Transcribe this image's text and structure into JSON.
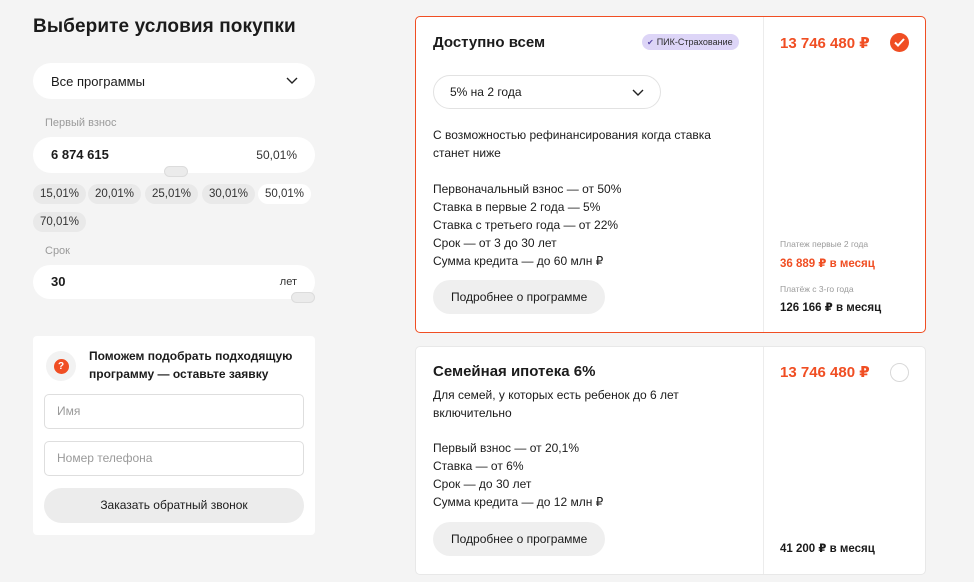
{
  "title": "Выберите условия покупки",
  "program_select": {
    "value": "Все программы",
    "icon": "chevron-down-icon"
  },
  "down_payment": {
    "label": "Первый взнос",
    "value": "6 874 615",
    "percent": "50,01%",
    "slider_position": 0.5,
    "chips": [
      "15,01%",
      "20,01%",
      "25,01%",
      "30,01%",
      "50,01%",
      "70,01%"
    ],
    "active_chip": "50,01%"
  },
  "term": {
    "label": "Срок",
    "value": "30",
    "unit": "лет",
    "slider_position": 1.0
  },
  "help": {
    "icon": "question-icon",
    "icon_glyph": "?",
    "text": "Поможем подобрать подходящую программу — оставьте заявку",
    "name_placeholder": "Имя",
    "phone_placeholder": "Номер телефона",
    "button": "Заказать обратный звонок"
  },
  "accent_color": "#f04e23",
  "programs": [
    {
      "title": "Доступно всем",
      "badge": "ПИК-Страхование",
      "badge_icon": "check-icon",
      "rate_select": "5% на 2 года",
      "description": "С возможностью рефинансирования когда ставка станет ниже",
      "conditions": [
        "Первоначальный взнос — от 50%",
        "Ставка в первые 2 года — 5%",
        "Ставка с третьего года — от 22%",
        "Срок — от 3 до 30 лет",
        "Сумма кредита — до 60 млн ₽"
      ],
      "details_button": "Подробнее о программе",
      "price": "13 746 480 ₽",
      "selected": true,
      "payment_label_1": "Платеж первые 2 года",
      "payment_value_1": "36 889 ₽ в месяц",
      "payment_label_2": "Платёж с 3-го года",
      "payment_value_2": "126 166 ₽ в месяц"
    },
    {
      "title": "Семейная ипотека 6%",
      "description": "Для семей, у которых есть ребенок до 6 лет включительно",
      "conditions": [
        "Первый взнос — от 20,1%",
        "Ставка — от 6%",
        "Срок — до 30 лет",
        "Сумма кредита — до 12 млн ₽"
      ],
      "details_button": "Подробнее о программе",
      "price": "13 746 480 ₽",
      "selected": false,
      "payment_value": "41 200 ₽ в месяц"
    }
  ]
}
